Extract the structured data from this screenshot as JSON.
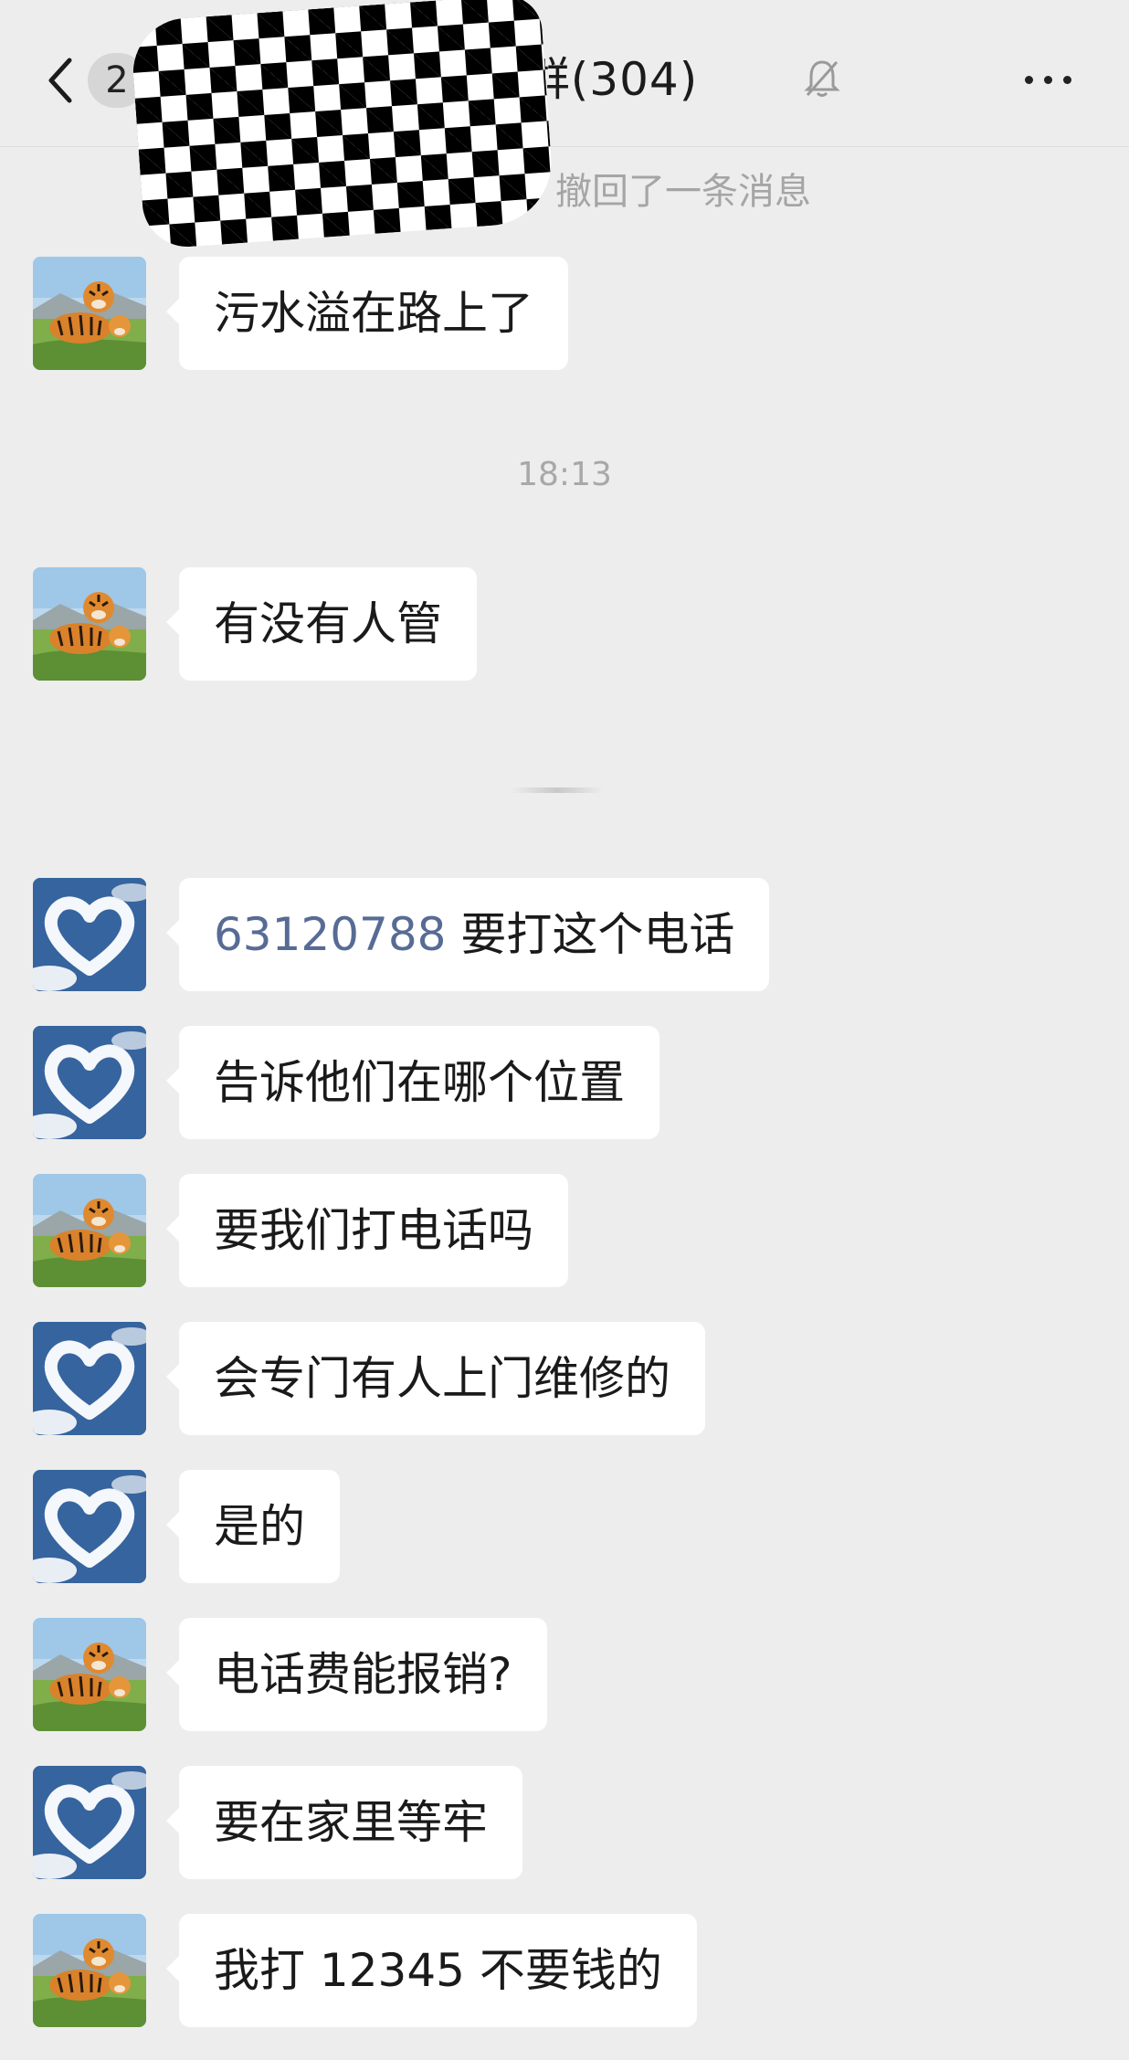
{
  "header": {
    "unread_count": "2",
    "title": "村民群(304)"
  },
  "system_message": "撤回了一条消息",
  "timestamps": [
    "18:13"
  ],
  "messages": [
    {
      "avatar": "tiger-avatar",
      "text": "污水溢在路上了"
    },
    {
      "avatar": "tiger-avatar",
      "text": "有没有人管"
    },
    {
      "avatar": "heart-cloud-avatar",
      "link": "63120788",
      "text": " 要打这个电话"
    },
    {
      "avatar": "heart-cloud-avatar",
      "text": "告诉他们在哪个位置"
    },
    {
      "avatar": "tiger-avatar",
      "text": "要我们打电话吗"
    },
    {
      "avatar": "heart-cloud-avatar",
      "text": "会专门有人上门维修的"
    },
    {
      "avatar": "heart-cloud-avatar",
      "text": "是的"
    },
    {
      "avatar": "tiger-avatar",
      "text": "电话费能报销?"
    },
    {
      "avatar": "heart-cloud-avatar",
      "text": "要在家里等牢"
    },
    {
      "avatar": "tiger-avatar",
      "text": "我打 12345 不要钱的"
    }
  ],
  "colors": {
    "background": "#ededed",
    "bubble": "#ffffff",
    "link": "#576b95",
    "system_text": "#a5a5a5"
  }
}
